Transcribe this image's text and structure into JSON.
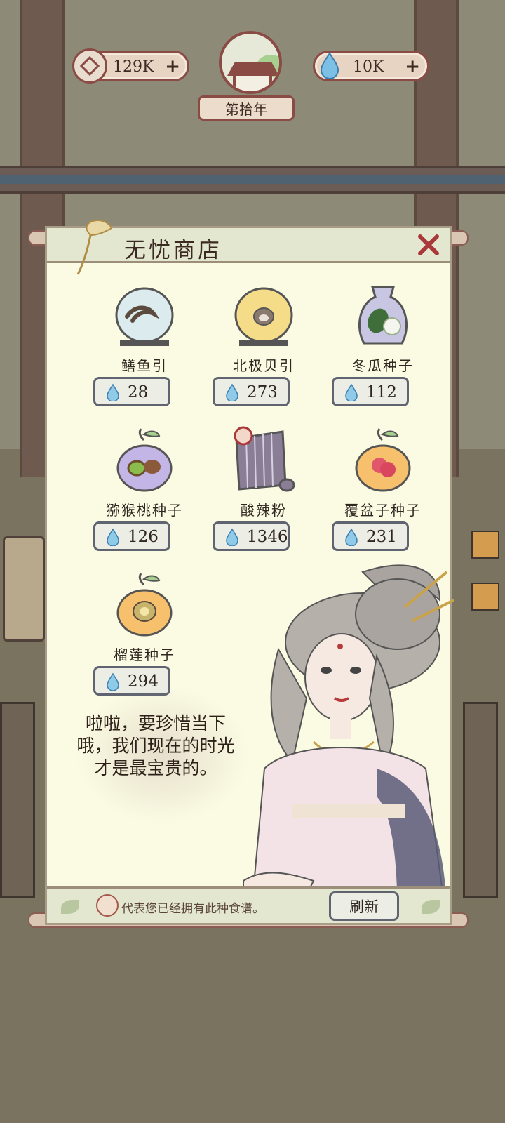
{
  "resources": {
    "coins": {
      "value": "129K",
      "icon": "coin-icon",
      "plus": "+"
    },
    "water": {
      "value": "10K",
      "icon": "water-drop-icon",
      "plus": "+"
    },
    "year": "第拾年"
  },
  "shop": {
    "title": "无忧商店",
    "close_icon": "close-icon",
    "items": [
      {
        "name": "鳝鱼引",
        "price": "28",
        "icon": "eel-jar-icon"
      },
      {
        "name": "北极贝引",
        "price": "273",
        "icon": "clam-jar-icon"
      },
      {
        "name": "冬瓜种子",
        "price": "112",
        "icon": "wintermelon-seed-bag-icon"
      },
      {
        "name": "猕猴桃种子",
        "price": "126",
        "icon": "kiwi-seed-bag-icon"
      },
      {
        "name": "酸辣粉",
        "price": "1346",
        "icon": "recipe-scroll-icon"
      },
      {
        "name": "覆盆子种子",
        "price": "231",
        "icon": "raspberry-seed-bag-icon"
      },
      {
        "name": "榴莲种子",
        "price": "294",
        "icon": "durian-seed-bag-icon"
      }
    ],
    "speech": "啦啦，要珍惜当下哦，我们现在的时光才是最宝贵的。",
    "legend": "代表您已经拥有此种食谱。",
    "refresh": "刷新"
  },
  "colors": {
    "panel": "#fbfbe3",
    "border": "#8a4b44",
    "water": "#5aa7d6"
  }
}
